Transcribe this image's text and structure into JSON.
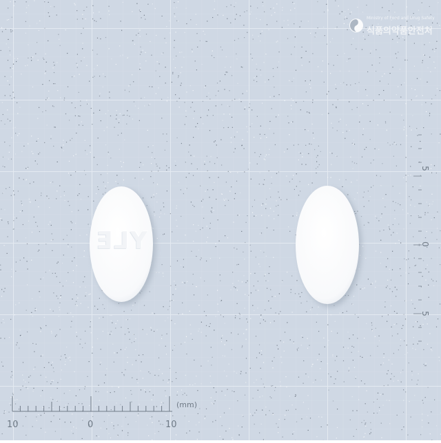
{
  "photo": {
    "background_color": "#cfd8e4",
    "grid_color": "#e3e9f0",
    "tablet_color": "#ffffff"
  },
  "watermark": {
    "logo_icon": "agency-logo-icon",
    "line1": "Ministry of Food and Drug Safety",
    "line2": "식품의약품안전처"
  },
  "tablet_front": {
    "imprint": "YLE"
  },
  "tablet_back": {
    "imprint": ""
  },
  "bottom_ruler": {
    "labels": [
      "10",
      "0",
      "10"
    ],
    "unit": "(mm)"
  },
  "side_ruler": {
    "labels": [
      "5",
      "0",
      "5"
    ]
  }
}
